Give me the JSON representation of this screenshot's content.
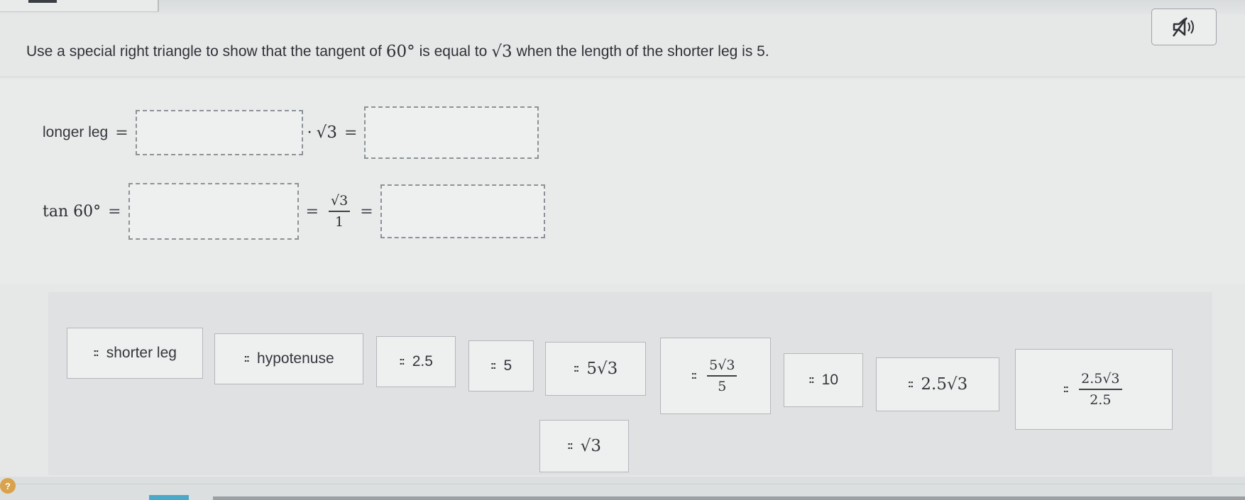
{
  "question": {
    "part1": "Use a special right triangle to show that the tangent of",
    "angle": "60°",
    "part2": "is equal to",
    "value": "√3",
    "part3": "when the length of the shorter leg is 5."
  },
  "equation1": {
    "label": "longer leg",
    "eq1": "=",
    "dot": "·",
    "sqrt": "√3",
    "eq2": "="
  },
  "equation2": {
    "label": "tan 60°",
    "eq1": "=",
    "eq2": "=",
    "frac_num": "√3",
    "frac_den": "1",
    "eq3": "="
  },
  "grip": "::",
  "answer_bank": [
    {
      "text": "shorter leg"
    },
    {
      "text": "hypotenuse"
    },
    {
      "text": "2.5"
    },
    {
      "text": "5"
    },
    {
      "text": "5√3"
    },
    {
      "num": "5√3",
      "den": "5"
    },
    {
      "text": "10"
    },
    {
      "text": "2.5√3"
    },
    {
      "num": "2.5√3",
      "den": "2.5"
    },
    {
      "text": "√3"
    }
  ],
  "help_badge": "?",
  "icons": {
    "text_to_speech": "speaker-muted-icon",
    "help": "help-icon"
  }
}
